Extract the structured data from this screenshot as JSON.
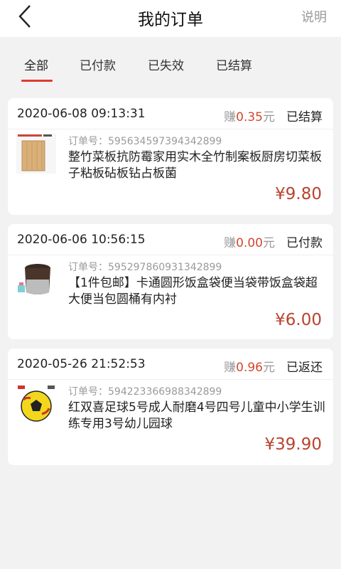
{
  "header": {
    "title": "我的订单",
    "explain": "说明"
  },
  "tabs": [
    {
      "label": "全部",
      "active": true
    },
    {
      "label": "已付款",
      "active": false
    },
    {
      "label": "已失效",
      "active": false
    },
    {
      "label": "已结算",
      "active": false
    }
  ],
  "orders": [
    {
      "datetime": "2020-06-08 09:13:31",
      "earn_prefix": "赚",
      "earn_amount": "0.35",
      "earn_unit": "元",
      "status": "已结算",
      "order_no": "订单号：595634597394342899",
      "name": "整竹菜板抗防霉家用实木全竹制案板厨房切菜板子粘板砧板钻占板菌",
      "price": "¥9.80",
      "thumb_icon": "bamboo-cutting-board-image"
    },
    {
      "datetime": "2020-06-06 10:56:15",
      "earn_prefix": "赚",
      "earn_amount": "0.00",
      "earn_unit": "元",
      "status": "已付款",
      "order_no": "订单号：595297860931342899",
      "name": "【1件包邮】卡通圆形饭盒袋便当袋带饭盒袋超大便当包圆桶有内衬",
      "price": "¥6.00",
      "thumb_icon": "lunch-bag-image"
    },
    {
      "datetime": "2020-05-26 21:52:53",
      "earn_prefix": "赚",
      "earn_amount": "0.96",
      "earn_unit": "元",
      "status": "已返还",
      "order_no": "订单号：594223366988342899",
      "name": "红双喜足球5号成人耐磨4号四号儿童中小学生训练专用3号幼儿园球",
      "price": "¥39.90",
      "thumb_icon": "football-image"
    }
  ],
  "colors": {
    "accent": "#e03a2f",
    "price": "#b9432f",
    "earn": "#d6452f"
  }
}
